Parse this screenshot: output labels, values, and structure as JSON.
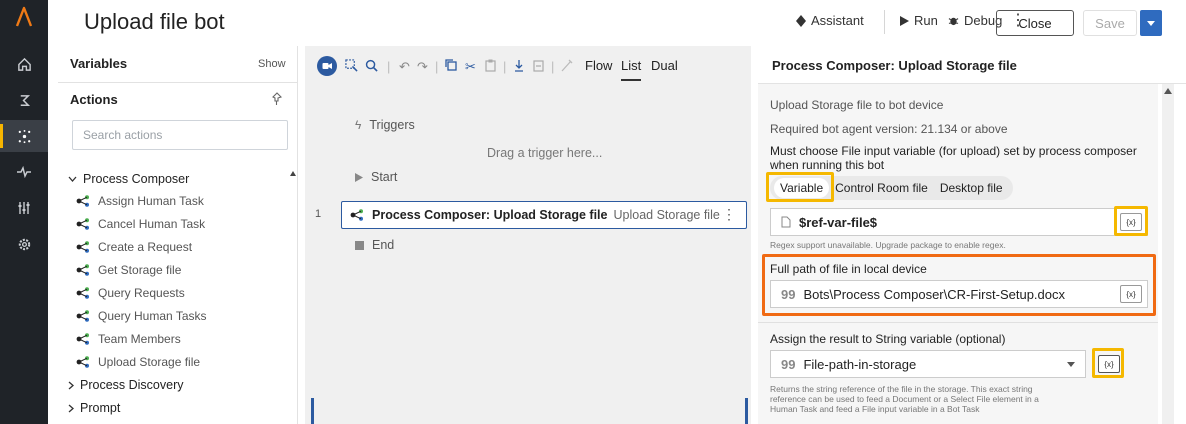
{
  "app": {
    "title": "Upload file bot"
  },
  "header": {
    "assistant": "Assistant",
    "run": "Run",
    "debug": "Debug",
    "close": "Close",
    "save": "Save"
  },
  "rail": {
    "items": [
      "home-icon",
      "bot-icon",
      "hub-icon",
      "pulse-icon",
      "sliders-icon",
      "gear-icon"
    ],
    "active_index": 2,
    "accent": "#f7b500"
  },
  "left_panel": {
    "variables_label": "Variables",
    "show_label": "Show",
    "actions_label": "Actions",
    "search_placeholder": "Search actions",
    "category_open": "Process Composer",
    "items": [
      "Assign Human Task",
      "Cancel Human Task",
      "Create a Request",
      "Get Storage file",
      "Query Requests",
      "Query Human Tasks",
      "Team Members",
      "Upload Storage file"
    ],
    "category_closed_1": "Process Discovery",
    "category_closed_2": "Prompt"
  },
  "canvas": {
    "tabs": [
      "Flow",
      "List",
      "Dual"
    ],
    "active_tab": "List",
    "triggers_label": "Triggers",
    "drop_hint": "Drag a trigger here...",
    "start_label": "Start",
    "step_number": "1",
    "step_title": "Process Composer: Upload Storage file",
    "step_subtitle": "Upload Storage file",
    "end_label": "End"
  },
  "right_panel": {
    "title": "Process Composer: Upload Storage file",
    "description": "Upload Storage file to bot device",
    "version_note": "Required bot agent version: 21.134 or above",
    "choose_note_line1": "Must choose File input variable (for upload) set by process composer",
    "choose_note_line2": "when running this bot",
    "source_options": [
      "Variable",
      "Control Room file",
      "Desktop file"
    ],
    "selected_source": "Variable",
    "file_variable": "$ref-var-file$",
    "regex_note": "Regex support unavailable. Upgrade package to enable regex.",
    "local_path_label": "Full path of file in local device",
    "local_path_value": "Bots\\Process Composer\\CR-First-Setup.docx",
    "assign_label": "Assign the result to String variable (optional)",
    "assign_value": "File-path-in-storage",
    "returns_note_line1": "Returns the string reference of the file in the storage. This exact string",
    "returns_note_line2": "reference can be used to feed a Document or a Select File element in a",
    "returns_note_line3": "Human Task and feed a File input variable in a Bot Task",
    "var_button": "{x}"
  },
  "colors": {
    "highlight_yellow": "#f5b800",
    "highlight_orange": "#f06a13",
    "accent_blue": "#2c5aa0"
  }
}
